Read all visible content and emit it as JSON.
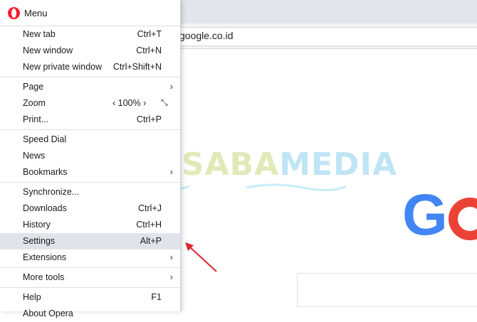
{
  "address": {
    "url": "google.co.id"
  },
  "watermark": {
    "part1": "NESABA",
    "part2": "MEDIA"
  },
  "google": {
    "letter": "G"
  },
  "menu": {
    "title": "Menu",
    "items": [
      {
        "label": "New tab",
        "shortcut": "Ctrl+T"
      },
      {
        "label": "New window",
        "shortcut": "Ctrl+N"
      },
      {
        "label": "New private window",
        "shortcut": "Ctrl+Shift+N"
      },
      {
        "label": "Page",
        "arrow": "›"
      },
      {
        "label": "Zoom",
        "zoom": "‹ 100% ›",
        "fullscreen": "⤡"
      },
      {
        "label": "Print...",
        "shortcut": "Ctrl+P"
      },
      {
        "label": "Speed Dial"
      },
      {
        "label": "News"
      },
      {
        "label": "Bookmarks",
        "arrow": "›"
      },
      {
        "label": "Synchronize..."
      },
      {
        "label": "Downloads",
        "shortcut": "Ctrl+J"
      },
      {
        "label": "History",
        "shortcut": "Ctrl+H"
      },
      {
        "label": "Settings",
        "shortcut": "Alt+P"
      },
      {
        "label": "Extensions",
        "arrow": "›"
      },
      {
        "label": "More tools",
        "arrow": "›"
      },
      {
        "label": "Help",
        "shortcut": "F1"
      },
      {
        "label": "About Opera"
      }
    ]
  },
  "colors": {
    "opera_red": "#ff1b2d",
    "highlight": "#e0e4ea",
    "arrow_red": "#d9262f"
  }
}
